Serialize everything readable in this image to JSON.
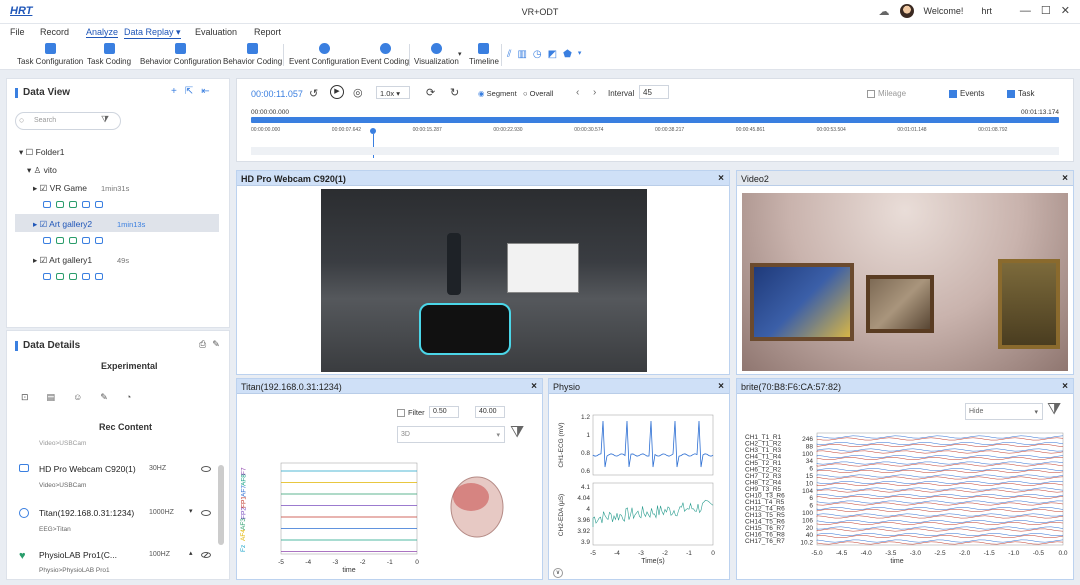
{
  "app": {
    "logo": "HRT",
    "title": "VR+ODT",
    "welcome": "Welcome!",
    "user": "hrt",
    "win_min": "—",
    "win_max": "☐",
    "win_close": "✕"
  },
  "menu": [
    "File",
    "Record",
    "Analyze",
    "Data Replay ▾",
    "Evaluation",
    "Report"
  ],
  "toolbar": {
    "items": [
      "Task Configuration",
      "Task Coding",
      "Behavior Configuration",
      "Behavior Coding",
      "Event Configuration",
      "Event Coding",
      "Visualization",
      "Timeline"
    ]
  },
  "dataview": {
    "title": "Data View",
    "search_placeholder": "Search",
    "tree": {
      "folder": "Folder1",
      "user": "vito",
      "sessions": [
        {
          "name": "VR Game",
          "duration": "1min31s"
        },
        {
          "name": "Art gallery2",
          "duration": "1min13s",
          "selected": true
        },
        {
          "name": "Art gallery1",
          "duration": "49s"
        }
      ]
    }
  },
  "datadetails": {
    "title": "Data Details",
    "experimental": "Experimental",
    "rec_content": "Rec Content",
    "cut_sub": "Video>USBCam",
    "devices": [
      {
        "name": "HD Pro Webcam C920(1)",
        "sub": "Video>USBCam",
        "rate": "30HZ"
      },
      {
        "name": "Titan(192.168.0.31:1234)",
        "sub": "EEG>Titan",
        "rate": "1000HZ"
      },
      {
        "name": "PhysioLAB Pro1(C...",
        "sub": "Physio>PhysioLAB Pro1",
        "rate": "100HZ"
      }
    ]
  },
  "controls": {
    "time": "00:00:11.057",
    "speed": "1.0x",
    "segment": "Segment",
    "overall": "Overall",
    "interval_label": "Interval",
    "interval_value": "45",
    "mileage": "Mileage",
    "events": "Events",
    "task": "Task",
    "start_time": "00:00:00.000",
    "end_time": "00:01:13.174",
    "playhead_fraction": 0.151,
    "ticks": [
      "00:00:00.000",
      "00:00:07.642",
      "00:00:15.287",
      "00:00:22.930",
      "00:00:30.574",
      "00:00:38.217",
      "00:00:45.861",
      "00:00:53.504",
      "00:01:01.148",
      "00:01:08.792"
    ]
  },
  "panels": {
    "webcam": "HD Pro Webcam C920(1)",
    "video2": "Video2",
    "titan": "Titan(192.168.0.31:1234)",
    "physio": "Physio",
    "brite": "brite(70:B8:F6:CA:57:82)",
    "close": "×"
  },
  "titan": {
    "filter": "Filter",
    "low": "0.50",
    "high": "40.00",
    "mode": "3D",
    "xticks": [
      "-5",
      "-4",
      "-3",
      "-2",
      "-1",
      "0"
    ],
    "xlabel": "time",
    "channels": [
      "Fz",
      "AF4",
      "AF3",
      "FP2",
      "FP1",
      "AF7",
      "AF8",
      "F7"
    ]
  },
  "physio": {
    "ecg_label": "CH1-ECG (mV)",
    "eda_label": "CH2-EDA (μS)",
    "ecg_ticks": [
      "1.2",
      "1",
      "0.8",
      "0.6"
    ],
    "eda_ticks": [
      "4.1",
      "4.04",
      "4",
      "3.96",
      "3.92",
      "3.9"
    ],
    "xticks": [
      "-5",
      "-4",
      "-3",
      "-2",
      "-1",
      "0"
    ],
    "xlabel": "Time(s)"
  },
  "brite": {
    "hide": "Hide",
    "xticks": [
      "-5.0",
      "-4.5",
      "-4.0",
      "-3.5",
      "-3.0",
      "-2.5",
      "-2.0",
      "-1.5",
      "-1.0",
      "-0.5",
      "0.0"
    ],
    "xlabel": "time",
    "channels": [
      "CH1_T1_R1",
      "CH2_T1_R2",
      "CH3_T1_R3",
      "CH4_T1_R4",
      "CH5_T2_R1",
      "CH6_T2_R2",
      "CH7_T2_R3",
      "CH8_T2_R4",
      "CH9_T3_R5",
      "CH10_T3_R6",
      "CH11_T4_R5",
      "CH12_T4_R6",
      "CH13_T5_R5",
      "CH14_T5_R6",
      "CH15_T6_R7",
      "CH16_T6_R8",
      "CH17_T6_R7"
    ],
    "values": [
      "246",
      "88",
      "100",
      "34",
      "6",
      "15",
      "10",
      "104",
      "6",
      "6",
      "100",
      "106",
      "20",
      "40",
      "10.2"
    ]
  },
  "colors": {
    "accent": "#3a7fe0",
    "header": "#cfe0f7",
    "selected": "#dfe3ea"
  }
}
